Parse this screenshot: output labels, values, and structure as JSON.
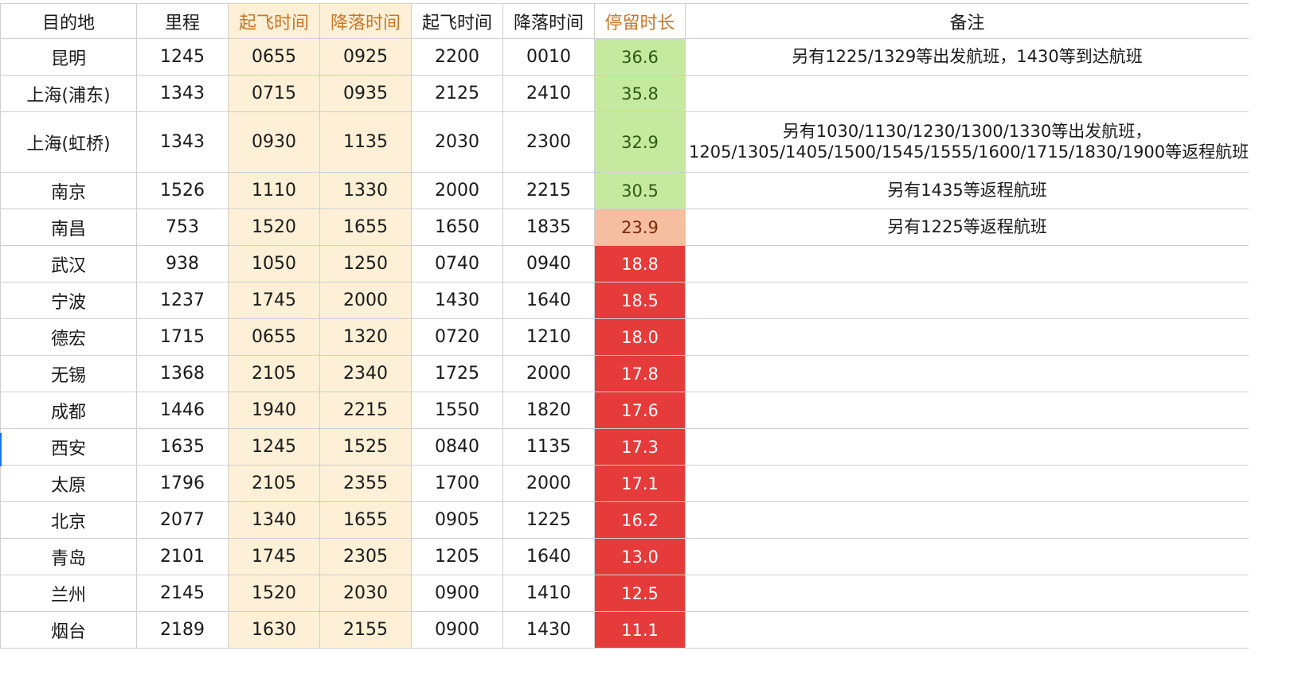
{
  "headers": [
    "目的地",
    "里程",
    "起飞时间",
    "降落时间",
    "起飞时间",
    "降落时间",
    "停留时长",
    "备注"
  ],
  "colors": {
    "highlight_column_bg": "#fdf0d6",
    "header_accent_text": "#c8762a",
    "stay_green": "#c6e9a0",
    "stay_orange": "#f6bea0",
    "stay_red": "#e63b3b",
    "row_marker": "#1a73e8"
  },
  "rows": [
    {
      "dest": "昆明",
      "miles": "1245",
      "dep1": "0655",
      "arr1": "0925",
      "dep2": "2200",
      "arr2": "0010",
      "stay": "36.6",
      "level": "green",
      "note": [
        "另有1225/1329等出发航班，1430等到达航班"
      ]
    },
    {
      "dest": "上海(浦东)",
      "miles": "1343",
      "dep1": "0715",
      "arr1": "0935",
      "dep2": "2125",
      "arr2": "2410",
      "stay": "35.8",
      "level": "green",
      "note": []
    },
    {
      "dest": "上海(虹桥)",
      "miles": "1343",
      "dep1": "0930",
      "arr1": "1135",
      "dep2": "2030",
      "arr2": "2300",
      "stay": "32.9",
      "level": "green",
      "note": [
        "另有1030/1130/1230/1300/1330等出发航班，",
        "1205/1305/1405/1500/1545/1555/1600/1715/1830/1900等返程航班"
      ]
    },
    {
      "dest": "南京",
      "miles": "1526",
      "dep1": "1110",
      "arr1": "1330",
      "dep2": "2000",
      "arr2": "2215",
      "stay": "30.5",
      "level": "green",
      "note": [
        "另有1435等返程航班"
      ]
    },
    {
      "dest": "南昌",
      "miles": "753",
      "dep1": "1520",
      "arr1": "1655",
      "dep2": "1650",
      "arr2": "1835",
      "stay": "23.9",
      "level": "orange",
      "note": [
        "另有1225等返程航班"
      ]
    },
    {
      "dest": "武汉",
      "miles": "938",
      "dep1": "1050",
      "arr1": "1250",
      "dep2": "0740",
      "arr2": "0940",
      "stay": "18.8",
      "level": "red",
      "note": []
    },
    {
      "dest": "宁波",
      "miles": "1237",
      "dep1": "1745",
      "arr1": "2000",
      "dep2": "1430",
      "arr2": "1640",
      "stay": "18.5",
      "level": "red",
      "note": []
    },
    {
      "dest": "德宏",
      "miles": "1715",
      "dep1": "0655",
      "arr1": "1320",
      "dep2": "0720",
      "arr2": "1210",
      "stay": "18.0",
      "level": "red",
      "note": []
    },
    {
      "dest": "无锡",
      "miles": "1368",
      "dep1": "2105",
      "arr1": "2340",
      "dep2": "1725",
      "arr2": "2000",
      "stay": "17.8",
      "level": "red",
      "note": []
    },
    {
      "dest": "成都",
      "miles": "1446",
      "dep1": "1940",
      "arr1": "2215",
      "dep2": "1550",
      "arr2": "1820",
      "stay": "17.6",
      "level": "red",
      "note": []
    },
    {
      "dest": "西安",
      "miles": "1635",
      "dep1": "1245",
      "arr1": "1525",
      "dep2": "0840",
      "arr2": "1135",
      "stay": "17.3",
      "level": "red",
      "note": []
    },
    {
      "dest": "太原",
      "miles": "1796",
      "dep1": "2105",
      "arr1": "2355",
      "dep2": "1700",
      "arr2": "2000",
      "stay": "17.1",
      "level": "red",
      "note": []
    },
    {
      "dest": "北京",
      "miles": "2077",
      "dep1": "1340",
      "arr1": "1655",
      "dep2": "0905",
      "arr2": "1225",
      "stay": "16.2",
      "level": "red",
      "note": []
    },
    {
      "dest": "青岛",
      "miles": "2101",
      "dep1": "1745",
      "arr1": "2305",
      "dep2": "1205",
      "arr2": "1640",
      "stay": "13.0",
      "level": "red",
      "note": []
    },
    {
      "dest": "兰州",
      "miles": "2145",
      "dep1": "1520",
      "arr1": "2030",
      "dep2": "0900",
      "arr2": "1410",
      "stay": "12.5",
      "level": "red",
      "note": []
    },
    {
      "dest": "烟台",
      "miles": "2189",
      "dep1": "1630",
      "arr1": "2155",
      "dep2": "0900",
      "arr2": "1430",
      "stay": "11.1",
      "level": "red",
      "note": []
    }
  ]
}
